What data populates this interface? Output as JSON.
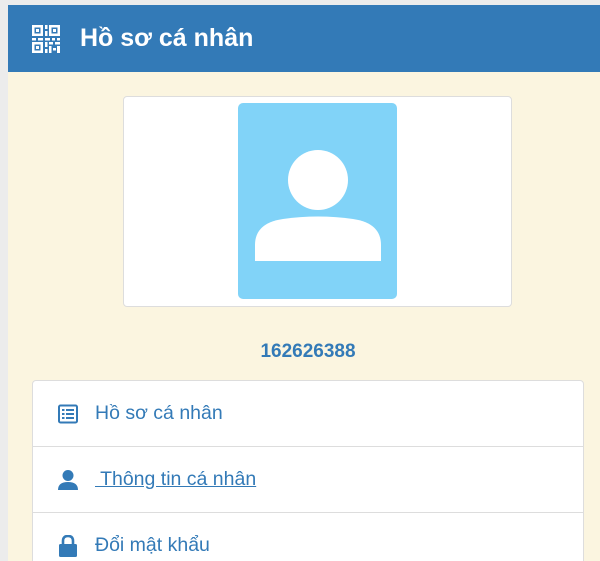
{
  "header": {
    "icon": "qrcode-icon",
    "title": "Hồ sơ cá nhân"
  },
  "profile": {
    "avatar_icon": "user-silhouette-icon",
    "user_id": "162626388"
  },
  "menu": {
    "items": [
      {
        "label": "Hồ sơ cá nhân",
        "icon": "list-alt-icon"
      },
      {
        "label": " Thông tin cá nhân",
        "icon": "user-icon",
        "active": true
      },
      {
        "label": "Đổi mật khẩu",
        "icon": "lock-icon"
      }
    ]
  },
  "colors": {
    "header_bg": "#337ab7",
    "panel_bg": "#fbf5e0",
    "avatar_bg": "#81d3f8",
    "text_link": "#337ab7"
  }
}
